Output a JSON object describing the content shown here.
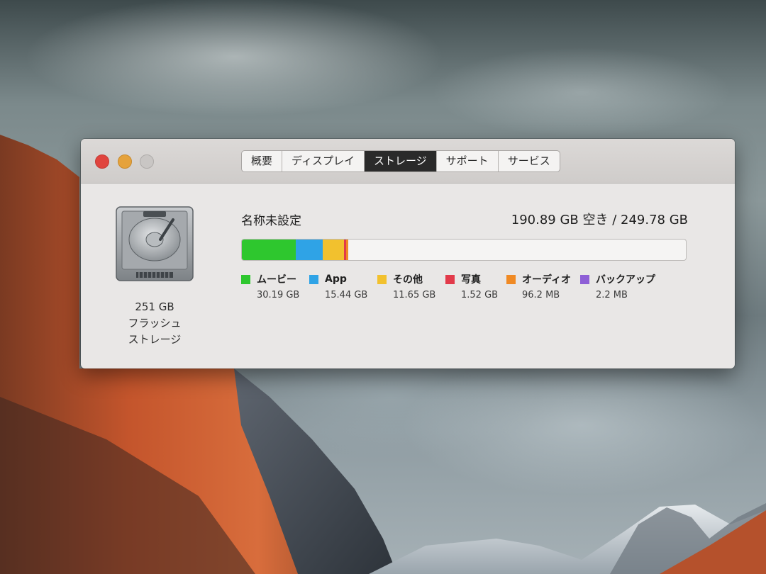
{
  "window": {
    "tabs": [
      "概要",
      "ディスプレイ",
      "ストレージ",
      "サポート",
      "サービス"
    ],
    "active_tab": "ストレージ"
  },
  "drive": {
    "icon": "hard-drive-icon",
    "capacity": "251 GB",
    "type_line1": "フラッシュ",
    "type_line2": "ストレージ"
  },
  "storage": {
    "name": "名称未設定",
    "free_text": "190.89 GB 空き / 249.78 GB",
    "free_gb": 190.89,
    "total_gb": 249.78,
    "categories": [
      {
        "label": "ムービー",
        "size": "30.19 GB",
        "gb": 30.19,
        "color": "#2ec72e"
      },
      {
        "label": "App",
        "size": "15.44 GB",
        "gb": 15.44,
        "color": "#2fa3e6"
      },
      {
        "label": "その他",
        "size": "11.65 GB",
        "gb": 11.65,
        "color": "#f2c12e"
      },
      {
        "label": "写真",
        "size": "1.52 GB",
        "gb": 1.52,
        "color": "#e23a4a"
      },
      {
        "label": "オーディオ",
        "size": "96.2 MB",
        "gb": 0.0962,
        "color": "#f08a24"
      },
      {
        "label": "バックアップ",
        "size": "2.2 MB",
        "gb": 0.0022,
        "color": "#8e5fd6"
      }
    ]
  }
}
